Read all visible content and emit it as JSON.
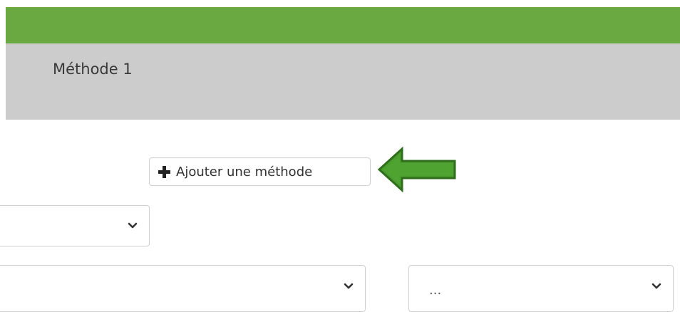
{
  "tab": {
    "title": "Méthode 1"
  },
  "add_method": {
    "label": "Ajouter une méthode",
    "icon": "plus-icon"
  },
  "annotation": {
    "icon": "arrow-left-icon",
    "color": "#4a9c2e"
  },
  "selects": [
    {
      "value": ""
    },
    {
      "value": ""
    },
    {
      "value": "..."
    }
  ],
  "colors": {
    "top_bar": "#6aa841",
    "tab_header": "#cccccc"
  }
}
